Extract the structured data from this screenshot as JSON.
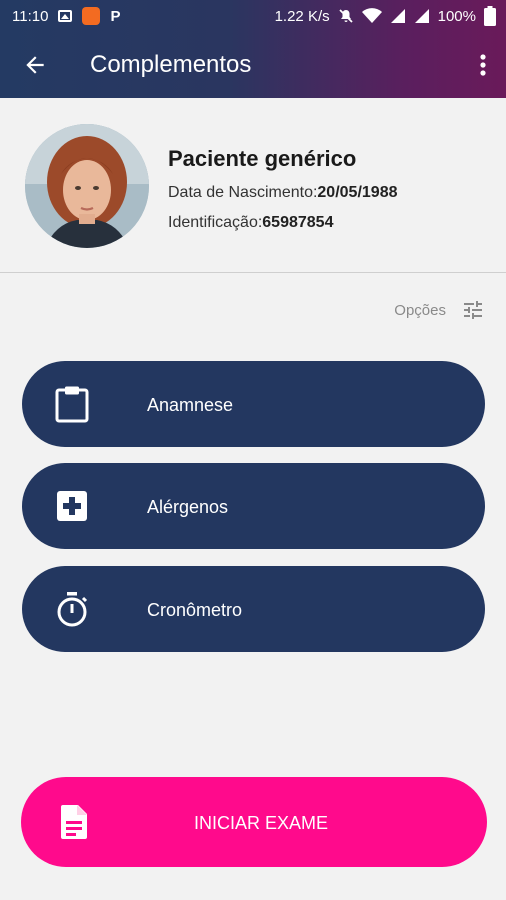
{
  "status_bar": {
    "time": "11:10",
    "app_letter": "P",
    "net_speed": "1.22 K/s",
    "battery": "100%"
  },
  "app_bar": {
    "title": "Complementos",
    "back_icon": "arrow-left-icon",
    "more_icon": "more-vert-icon"
  },
  "patient": {
    "name": "Paciente genérico",
    "dob_label": "Data de Nascimento:",
    "dob_value": "20/05/1988",
    "id_label": "Identificação:",
    "id_value": "65987854"
  },
  "options": {
    "label": "Opções",
    "icon": "tune-icon"
  },
  "menu": [
    {
      "label": "Anamnese",
      "icon": "clipboard-icon"
    },
    {
      "label": "Alérgenos",
      "icon": "medical-plus-icon"
    },
    {
      "label": "Cronômetro",
      "icon": "stopwatch-icon"
    }
  ],
  "start_button": {
    "label": "INICIAR EXAME",
    "icon": "document-icon"
  },
  "colors": {
    "menu_button": "#233760",
    "start_button": "#ff0a8c",
    "background": "#f2f2f2"
  }
}
